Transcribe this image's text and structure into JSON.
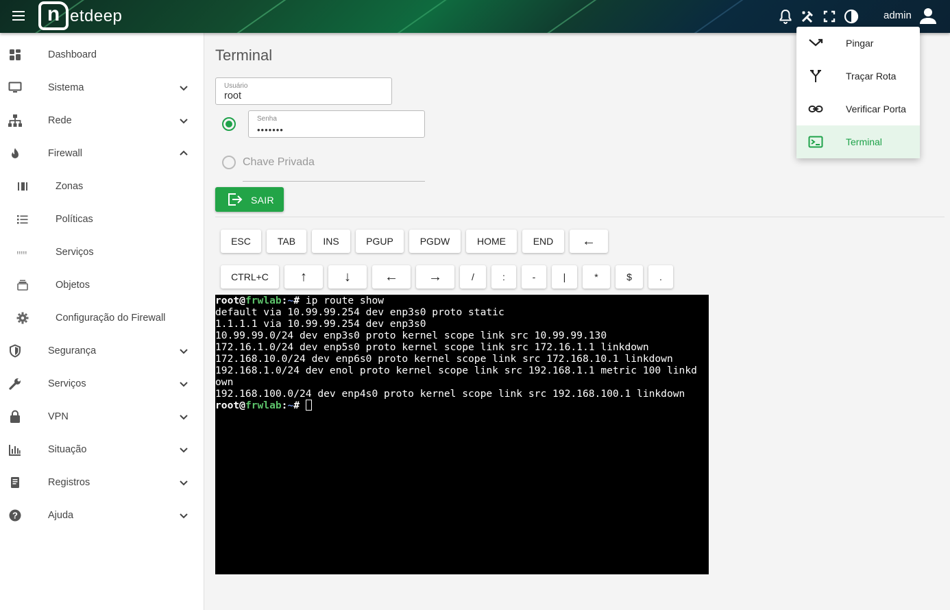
{
  "app": {
    "brand_n": "n",
    "brand_rest": "etdeep",
    "user": "admin",
    "accent_color": "#22a447"
  },
  "header_icons": [
    "menu-icon",
    "bell-icon",
    "tools-icon",
    "fullscreen-icon",
    "contrast-icon",
    "account-icon"
  ],
  "sidebar": {
    "items": [
      {
        "label": "Dashboard",
        "icon": "dashboard-icon"
      },
      {
        "label": "Sistema",
        "icon": "monitor-icon",
        "expandable": true
      },
      {
        "label": "Rede",
        "icon": "network-icon",
        "expandable": true
      },
      {
        "label": "Firewall",
        "icon": "flame-icon",
        "expandable": true,
        "expanded": true
      },
      {
        "label": "Zonas",
        "icon": "zones-icon",
        "sub": true
      },
      {
        "label": "Políticas",
        "icon": "list-icon",
        "sub": true
      },
      {
        "label": "Serviços",
        "icon": "dots-icon",
        "sub": true
      },
      {
        "label": "Objetos",
        "icon": "objects-icon",
        "sub": true
      },
      {
        "label": "Configuração do Firewall",
        "icon": "gear-icon",
        "sub": true
      },
      {
        "label": "Segurança",
        "icon": "shield-icon",
        "expandable": true
      },
      {
        "label": "Serviços",
        "icon": "wrench-icon",
        "expandable": true
      },
      {
        "label": "VPN",
        "icon": "lock-icon",
        "expandable": true
      },
      {
        "label": "Situação",
        "icon": "chart-icon",
        "expandable": true
      },
      {
        "label": "Registros",
        "icon": "book-icon",
        "expandable": true
      },
      {
        "label": "Ajuda",
        "icon": "help-icon",
        "expandable": true
      }
    ]
  },
  "main": {
    "title": "Terminal",
    "usuario": {
      "label": "Usuário",
      "value": "root"
    },
    "senha": {
      "label": "Senha",
      "value": "•••••••",
      "selected": true
    },
    "chave_privada": {
      "label": "Chave Privada",
      "selected": false
    },
    "sair_label": "SAIR"
  },
  "keys_row1": [
    "ESC",
    "TAB",
    "INS",
    "PGUP",
    "PGDW",
    "HOME",
    "END",
    "←"
  ],
  "keys_row2": [
    "CTRL+C",
    "↑",
    "↓",
    "←",
    "→",
    "/",
    ":",
    "-",
    "|",
    "*",
    "$",
    "."
  ],
  "terminal": {
    "user": "root",
    "host": "frwlab",
    "path": "~",
    "command": "ip route show",
    "output": [
      "default via 10.99.99.254 dev enp3s0 proto static",
      "1.1.1.1 via 10.99.99.254 dev enp3s0",
      "10.99.99.0/24 dev enp3s0 proto kernel scope link src 10.99.99.130",
      "172.16.1.0/24 dev enp5s0 proto kernel scope link src 172.16.1.1 linkdown",
      "172.168.10.0/24 dev enp6s0 proto kernel scope link src 172.168.10.1 linkdown",
      "192.168.1.0/24 dev enol proto kernel scope link src 192.168.1.1 metric 100 linkd",
      "own",
      "192.168.100.0/24 dev enp4s0 proto kernel scope link src 192.168.100.1 linkdown"
    ]
  },
  "tools_menu": {
    "items": [
      {
        "label": "Pingar",
        "icon": "ping-icon"
      },
      {
        "label": "Traçar Rota",
        "icon": "route-icon"
      },
      {
        "label": "Verificar Porta",
        "icon": "link-icon"
      },
      {
        "label": "Terminal",
        "icon": "terminal-icon",
        "active": true
      }
    ]
  }
}
